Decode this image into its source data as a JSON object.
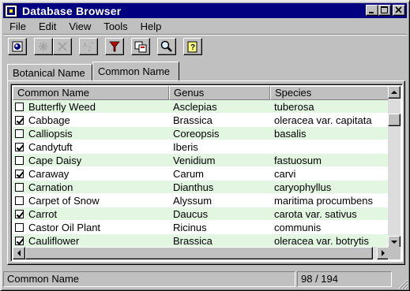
{
  "window": {
    "title": "Database Browser"
  },
  "menu": [
    "File",
    "Edit",
    "View",
    "Tools",
    "Help"
  ],
  "toolbar": {
    "icons": [
      "open-db-icon",
      "new-record-icon",
      "delete-icon",
      "sort-icon",
      "filter-icon",
      "copy-icon",
      "find-icon",
      "help-icon"
    ]
  },
  "tabs": {
    "botanical": "Botanical Name",
    "common": "Common Name"
  },
  "table": {
    "columns": [
      "Common Name",
      "Genus",
      "Species"
    ],
    "rows": [
      {
        "checked": false,
        "common": "Butterfly Weed",
        "genus": "Asclepias",
        "species": "tuberosa"
      },
      {
        "checked": true,
        "common": "Cabbage",
        "genus": "Brassica",
        "species": "oleracea var. capitata"
      },
      {
        "checked": false,
        "common": "Calliopsis",
        "genus": "Coreopsis",
        "species": "basalis"
      },
      {
        "checked": true,
        "common": "Candytuft",
        "genus": "Iberis",
        "species": ""
      },
      {
        "checked": false,
        "common": "Cape Daisy",
        "genus": "Venidium",
        "species": "fastuosum"
      },
      {
        "checked": true,
        "common": "Caraway",
        "genus": "Carum",
        "species": "carvi"
      },
      {
        "checked": false,
        "common": "Carnation",
        "genus": "Dianthus",
        "species": "caryophyllus"
      },
      {
        "checked": false,
        "common": "Carpet of Snow",
        "genus": "Alyssum",
        "species": "maritima procumbens"
      },
      {
        "checked": true,
        "common": "Carrot",
        "genus": "Daucus",
        "species": "carota var. sativus"
      },
      {
        "checked": false,
        "common": "Castor Oil Plant",
        "genus": "Ricinus",
        "species": "communis"
      },
      {
        "checked": true,
        "common": "Cauliflower",
        "genus": "Brassica",
        "species": "oleracea var. botrytis"
      }
    ]
  },
  "status": {
    "field": "Common Name",
    "position": "98 / 194"
  }
}
